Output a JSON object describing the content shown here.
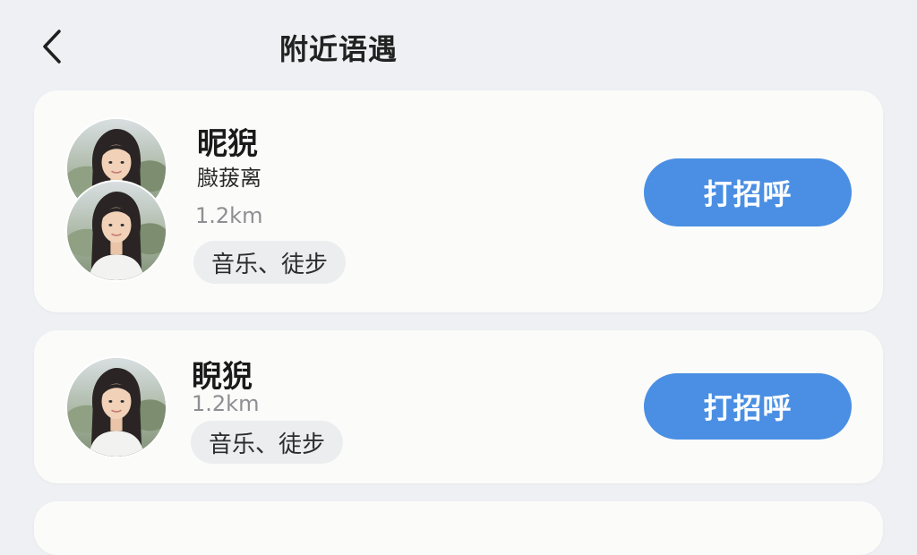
{
  "header": {
    "title": "附近语遇",
    "back_icon": "chevron-left-icon"
  },
  "users": [
    {
      "name": "昵猊",
      "subname": "臌菝离",
      "distance": "1.2km",
      "tag": "音乐、徒步",
      "button_label": "打招呼"
    },
    {
      "name": "睨猊",
      "distance": "1.2km",
      "tag": "音乐、徒步",
      "button_label": "打招呼"
    }
  ],
  "colors": {
    "background": "#eef0f3",
    "card": "#fbfbfa",
    "accent": "#4a8fe3",
    "tag_bg": "#ecedef",
    "muted_text": "#8e8e93"
  }
}
